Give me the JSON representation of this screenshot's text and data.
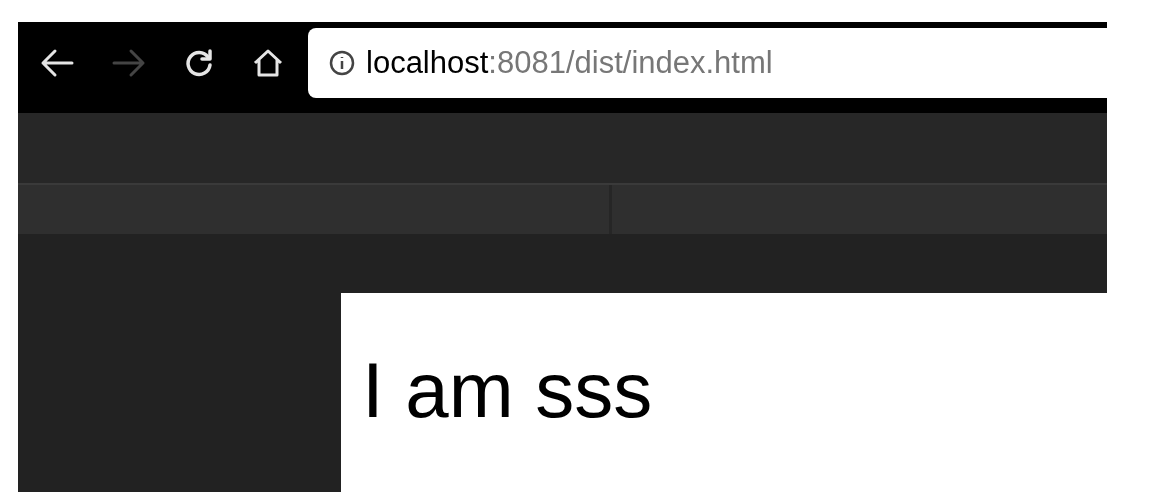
{
  "browser": {
    "back_disabled": false,
    "forward_disabled": true,
    "url_host": "localhost",
    "url_rest": ":8081/dist/index.html"
  },
  "page": {
    "heading": "I am sss"
  }
}
